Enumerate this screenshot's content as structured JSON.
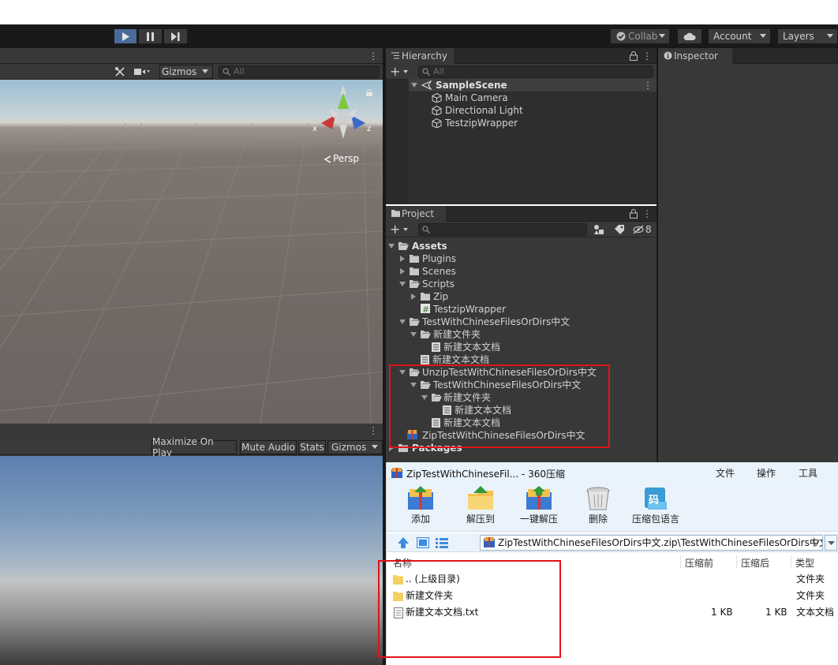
{
  "toolbar": {
    "collab_label": "Collab",
    "account_label": "Account",
    "layers_label": "Layers"
  },
  "scene": {
    "gizmos_label": "Gizmos",
    "search_placeholder": "All",
    "persp_label": "Persp",
    "axis_x": "x",
    "axis_z": "z"
  },
  "game": {
    "maximize_label": "Maximize On Play",
    "mute_label": "Mute Audio",
    "stats_label": "Stats",
    "gizmos_label": "Gizmos"
  },
  "hierarchy": {
    "tab_label": "Hierarchy",
    "search_placeholder": "All",
    "scene_name": "SampleScene",
    "objects": [
      "Main Camera",
      "Directional Light",
      "TestzipWrapper"
    ]
  },
  "inspector": {
    "tab_label": "Inspector"
  },
  "project": {
    "tab_label": "Project",
    "hidden_count": "8",
    "tree": [
      {
        "label": "Assets"
      },
      {
        "label": "Plugins"
      },
      {
        "label": "Scenes"
      },
      {
        "label": "Scripts"
      },
      {
        "label": "Zip"
      },
      {
        "label": "TestzipWrapper"
      },
      {
        "label": "TestWithChineseFilesOrDirs中文"
      },
      {
        "label": "新建文件夹"
      },
      {
        "label": "新建文本文档"
      },
      {
        "label": "新建文本文档"
      },
      {
        "label": "UnzipTestWithChineseFilesOrDirs中文"
      },
      {
        "label": "TestWithChineseFilesOrDirs中文"
      },
      {
        "label": "新建文件夹"
      },
      {
        "label": "新建文本文档"
      },
      {
        "label": "新建文本文档"
      },
      {
        "label": "ZipTestWithChineseFilesOrDirs中文"
      },
      {
        "label": "Packages"
      }
    ]
  },
  "zip_window": {
    "title": "ZipTestWithChineseFil... - 360压缩",
    "menu": [
      "文件",
      "操作",
      "工具"
    ],
    "tools": [
      "添加",
      "解压到",
      "一键解压",
      "删除",
      "压缩包语言"
    ],
    "tool4_glyph": "码",
    "address": "ZipTestWithChineseFilesOrDirs中文.zip\\TestWithChineseFilesOrDirs中文 - 解",
    "columns": [
      "名称",
      "压缩前",
      "压缩后",
      "类型"
    ],
    "rows": [
      {
        "name": ".. (上级目录)",
        "before": "",
        "after": "",
        "type": "文件夹"
      },
      {
        "name": "新建文件夹",
        "before": "",
        "after": "",
        "type": "文件夹"
      },
      {
        "name": "新建文本文档.txt",
        "before": "1 KB",
        "after": "1 KB",
        "type": "文本文档"
      }
    ]
  },
  "colors": {
    "highlight_box": "#e0121a",
    "unity_dark": "#383838",
    "play_active": "#4a6a9a"
  }
}
